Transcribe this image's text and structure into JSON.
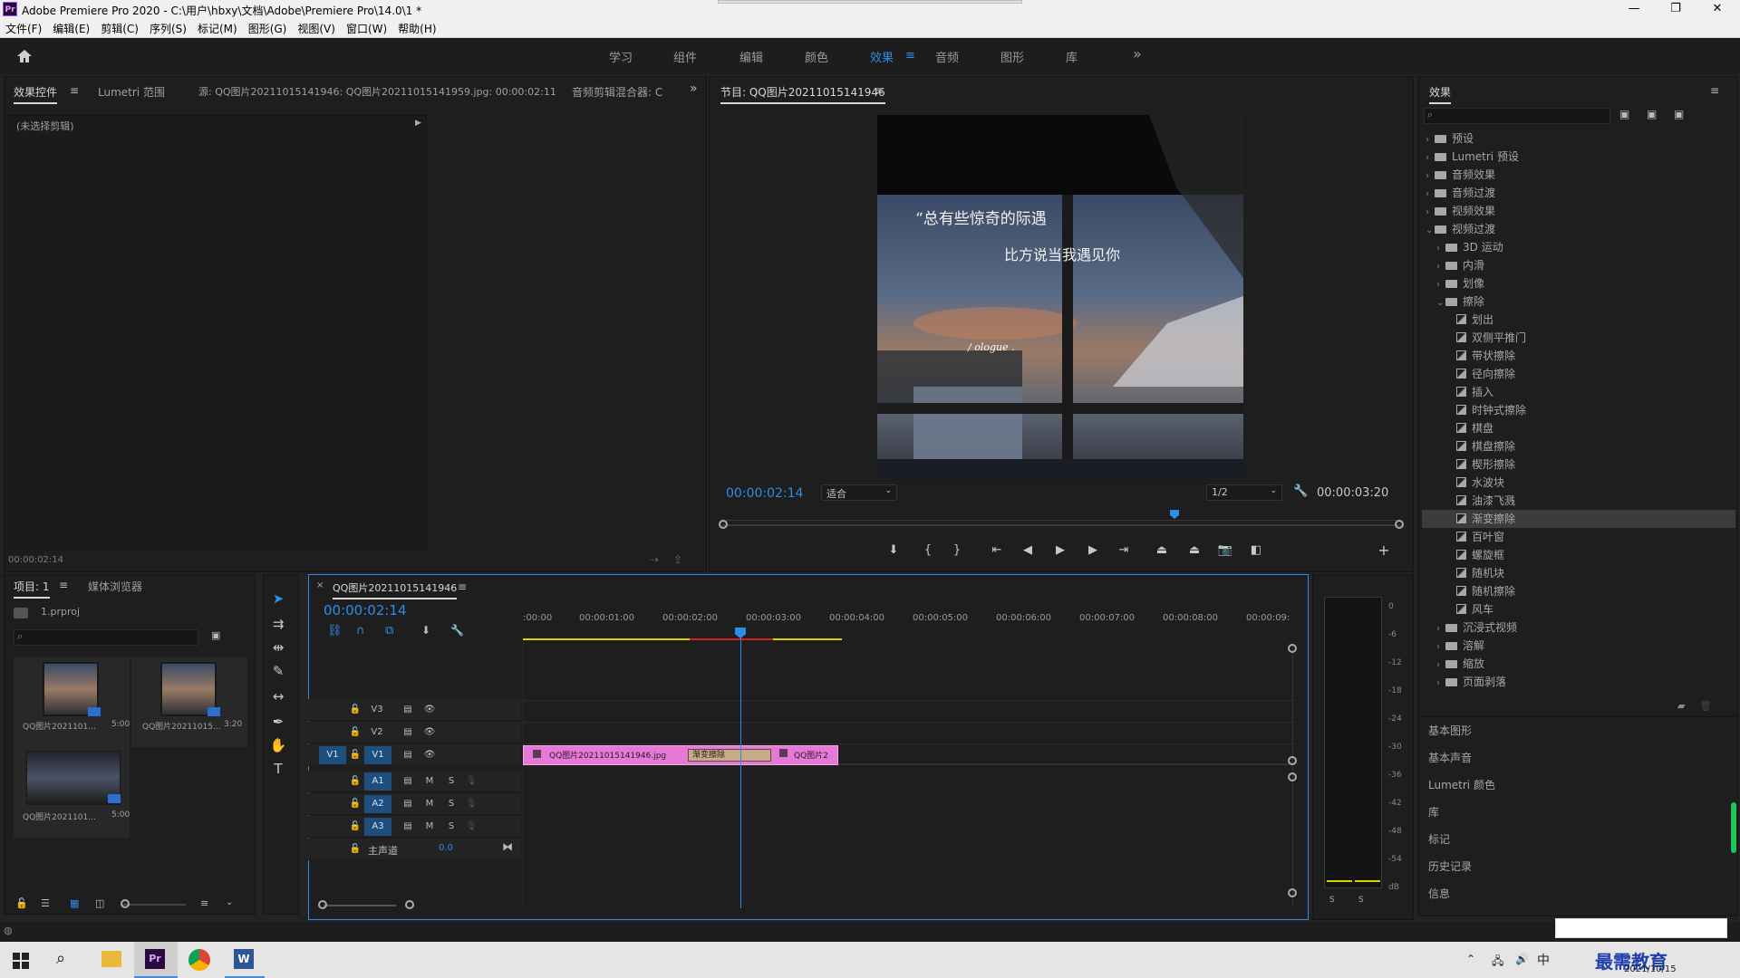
{
  "app": {
    "title": "Adobe Premiere Pro 2020 - C:\\用户\\hbxy\\文档\\Adobe\\Premiere Pro\\14.0\\1 *",
    "icon": "Pr"
  },
  "window_controls": {
    "minimize": "—",
    "maximize": "❐",
    "close": "✕"
  },
  "menu": [
    "文件(F)",
    "编辑(E)",
    "剪辑(C)",
    "序列(S)",
    "标记(M)",
    "图形(G)",
    "视图(V)",
    "窗口(W)",
    "帮助(H)"
  ],
  "workspaces": [
    {
      "label": "学习"
    },
    {
      "label": "组件"
    },
    {
      "label": "编辑"
    },
    {
      "label": "颜色"
    },
    {
      "label": "效果",
      "active": true
    },
    {
      "label": "音频"
    },
    {
      "label": "图形"
    },
    {
      "label": "库"
    }
  ],
  "workspace_more": "»",
  "source_panel": {
    "tabs": [
      "效果控件",
      "Lumetri 范围",
      "源: QQ图片20211015141946: QQ图片20211015141959.jpg: 00:00:02:11",
      "音频剪辑混合器: C"
    ],
    "no_clip": "(未选择剪辑)",
    "timecode": "00:00:02:14"
  },
  "program": {
    "title": "节目: QQ图片20211015141946",
    "timecode": "00:00:02:14",
    "fit": "适合",
    "resolution": "1/2",
    "duration": "00:00:03:20",
    "overlay_text_1": "“总有些惊奇的际遇",
    "overlay_text_2": "比方说当我遇见你",
    "overlay_text_3": "/ ologue ."
  },
  "project": {
    "tabs": [
      "项目: 1",
      "媒体浏览器"
    ],
    "file": "1.prproj",
    "items": [
      {
        "name": "QQ图片2021101...",
        "dur": "5:00"
      },
      {
        "name": "QQ图片20211015...",
        "dur": "3:20"
      },
      {
        "name": "QQ图片2021101...",
        "dur": "5:00"
      }
    ]
  },
  "timeline": {
    "tab": "QQ图片20211015141946",
    "timecode": "00:00:02:14",
    "ruler": [
      ":00:00",
      "00:00:01:00",
      "00:00:02:00",
      "00:00:03:00",
      "00:00:04:00",
      "00:00:05:00",
      "00:00:06:00",
      "00:00:07:00",
      "00:00:08:00",
      "00:00:09:"
    ],
    "video_tracks": [
      "V3",
      "V2",
      "V1"
    ],
    "audio_tracks": [
      "A1",
      "A2",
      "A3"
    ],
    "source_patch": "V1",
    "master": "主声道",
    "master_val": "0.0",
    "clip1": "QQ图片20211015141946.jpg",
    "transition": "渐变擦除",
    "clip2": "QQ图片2",
    "mute": "M",
    "solo": "S"
  },
  "meter": {
    "labels": [
      "0",
      "-6",
      "-12",
      "-18",
      "-24",
      "-30",
      "-36",
      "-42",
      "-48",
      "-54",
      "dB"
    ],
    "solo": [
      "S",
      "S"
    ]
  },
  "effects": {
    "title": "效果",
    "tree": [
      {
        "label": "预设",
        "level": 0,
        "type": "folder",
        "chev": "›"
      },
      {
        "label": "Lumetri 预设",
        "level": 0,
        "type": "folder",
        "chev": "›"
      },
      {
        "label": "音频效果",
        "level": 0,
        "type": "folder",
        "chev": "›"
      },
      {
        "label": "音频过渡",
        "level": 0,
        "type": "folder",
        "chev": "›"
      },
      {
        "label": "视频效果",
        "level": 0,
        "type": "folder",
        "chev": "›"
      },
      {
        "label": "视频过渡",
        "level": 0,
        "type": "folder",
        "chev": "⌄"
      },
      {
        "label": "3D 运动",
        "level": 1,
        "type": "folder",
        "chev": "›"
      },
      {
        "label": "内滑",
        "level": 1,
        "type": "folder",
        "chev": "›"
      },
      {
        "label": "划像",
        "level": 1,
        "type": "folder",
        "chev": "›"
      },
      {
        "label": "擦除",
        "level": 1,
        "type": "folder",
        "chev": "⌄"
      },
      {
        "label": "划出",
        "level": 2,
        "type": "effect"
      },
      {
        "label": "双侧平推门",
        "level": 2,
        "type": "effect"
      },
      {
        "label": "带状擦除",
        "level": 2,
        "type": "effect"
      },
      {
        "label": "径向擦除",
        "level": 2,
        "type": "effect"
      },
      {
        "label": "插入",
        "level": 2,
        "type": "effect"
      },
      {
        "label": "时钟式擦除",
        "level": 2,
        "type": "effect"
      },
      {
        "label": "棋盘",
        "level": 2,
        "type": "effect"
      },
      {
        "label": "棋盘擦除",
        "level": 2,
        "type": "effect"
      },
      {
        "label": "楔形擦除",
        "level": 2,
        "type": "effect"
      },
      {
        "label": "水波块",
        "level": 2,
        "type": "effect"
      },
      {
        "label": "油漆飞溅",
        "level": 2,
        "type": "effect"
      },
      {
        "label": "渐变擦除",
        "level": 2,
        "type": "effect",
        "selected": true
      },
      {
        "label": "百叶窗",
        "level": 2,
        "type": "effect"
      },
      {
        "label": "螺旋框",
        "level": 2,
        "type": "effect"
      },
      {
        "label": "随机块",
        "level": 2,
        "type": "effect"
      },
      {
        "label": "随机擦除",
        "level": 2,
        "type": "effect"
      },
      {
        "label": "风车",
        "level": 2,
        "type": "effect"
      },
      {
        "label": "沉浸式视频",
        "level": 1,
        "type": "folder",
        "chev": "›"
      },
      {
        "label": "溶解",
        "level": 1,
        "type": "folder",
        "chev": "›"
      },
      {
        "label": "缩放",
        "level": 1,
        "type": "folder",
        "chev": "›"
      },
      {
        "label": "页面剥落",
        "level": 1,
        "type": "folder",
        "chev": "›"
      }
    ],
    "sections": [
      "基本图形",
      "基本声音",
      "Lumetri 颜色",
      "库",
      "标记",
      "历史记录",
      "信息"
    ]
  },
  "taskbar": {
    "date": "2021/10/15",
    "ime": "中",
    "watermark": "最需教育"
  }
}
